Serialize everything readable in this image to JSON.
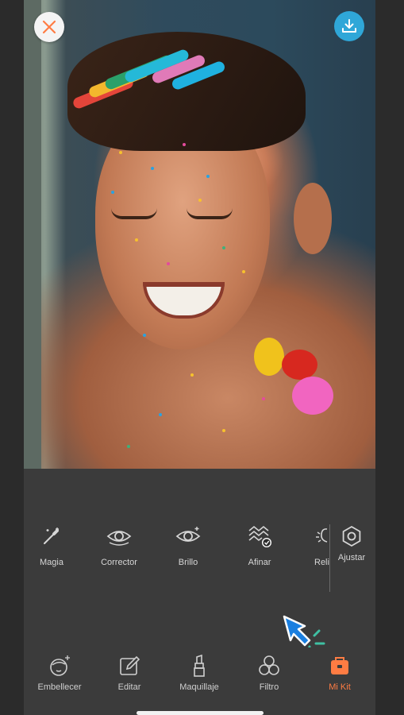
{
  "toolbar": {
    "close_icon": "close-icon",
    "download_icon": "download-icon",
    "close_color": "#ff7c43",
    "download_color": "#2fa7d8"
  },
  "tools": [
    {
      "icon": "magic-wand-icon",
      "label": "Magia"
    },
    {
      "icon": "eye-corrector-icon",
      "label": "Corrector"
    },
    {
      "icon": "eye-bright-icon",
      "label": "Brillo"
    },
    {
      "icon": "sharpen-icon",
      "label": "Afinar"
    },
    {
      "icon": "relight-icon",
      "label": "Reli"
    },
    {
      "icon": "adjust-icon",
      "label": "Ajustar"
    }
  ],
  "nav": [
    {
      "icon": "face-sparkle-icon",
      "label": "Embellecer"
    },
    {
      "icon": "edit-icon",
      "label": "Editar"
    },
    {
      "icon": "lipstick-icon",
      "label": "Maquillaje"
    },
    {
      "icon": "filter-icon",
      "label": "Filtro"
    },
    {
      "icon": "kit-icon",
      "label": "Mi Kit",
      "active": true
    }
  ],
  "accent_color": "#ff7c43"
}
